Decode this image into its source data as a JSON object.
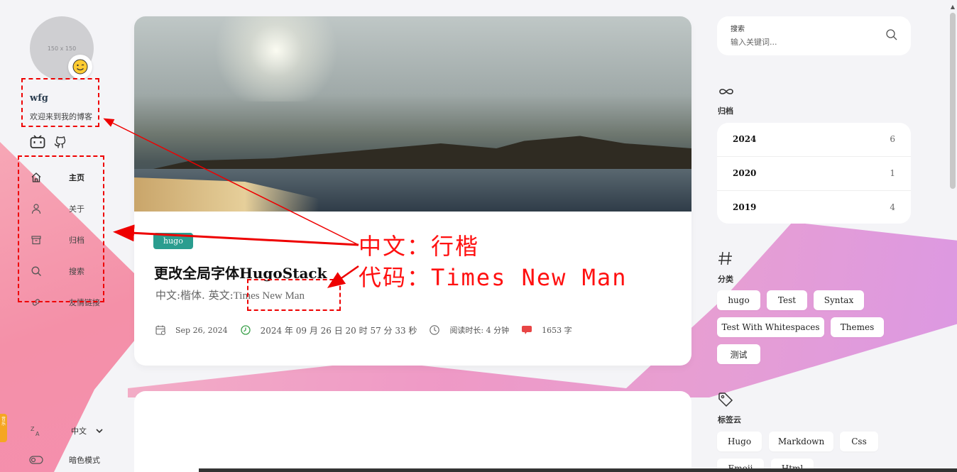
{
  "sidebar": {
    "avatar_placeholder": "150 x 150",
    "avatar_emoji": "😉",
    "site_name": "wfg",
    "site_desc": "欢迎来到我的博客",
    "menu": [
      {
        "label": "主页",
        "icon": "home-icon",
        "active": true
      },
      {
        "label": "关于",
        "icon": "user-icon",
        "active": false
      },
      {
        "label": "归档",
        "icon": "archive-icon",
        "active": false
      },
      {
        "label": "搜索",
        "icon": "search-icon",
        "active": false
      },
      {
        "label": "友情链接",
        "icon": "link-icon",
        "active": false
      }
    ],
    "language_label": "中文",
    "darkmode_label": "暗色模式",
    "side_tag": "音乐"
  },
  "annotations": {
    "line1": "中文：行楷",
    "line2": "代码：Times New Man"
  },
  "post": {
    "category": "hugo",
    "title": "更改全局字体HugoStack",
    "subtitle_prefix": "中文:楷体. 英文:",
    "subtitle_font": "Times New Man",
    "date": "Sep 26, 2024",
    "datetime": "2024 年 09 月 26 日 20 时 57 分 33 秒",
    "reading_time": "阅读时长: 4 分钟",
    "word_count": "1653 字"
  },
  "search": {
    "label": "搜索",
    "placeholder": "输入关键词..."
  },
  "archives": {
    "title": "归档",
    "items": [
      {
        "year": "2024",
        "count": "6"
      },
      {
        "year": "2020",
        "count": "1"
      },
      {
        "year": "2019",
        "count": "4"
      }
    ]
  },
  "categories": {
    "title": "分类",
    "items": [
      "hugo",
      "Test",
      "Syntax",
      "Test With Whitespaces",
      "Themes",
      "测试"
    ]
  },
  "tags": {
    "title": "标签云",
    "items": [
      "Hugo",
      "Markdown",
      "Css",
      "Emoji",
      "Html"
    ]
  },
  "colors": {
    "accent": "#2a9d8f",
    "annotation": "#ff1010",
    "background": "#f4f4f7"
  }
}
